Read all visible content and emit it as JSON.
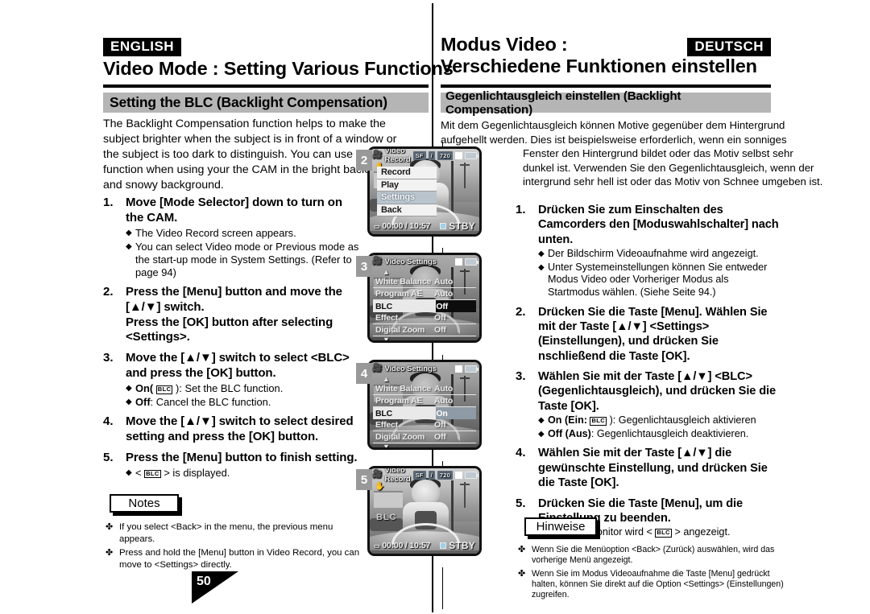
{
  "page": {
    "number": "50"
  },
  "english": {
    "lang_badge": "ENGLISH",
    "chapter_title_line1": "Video Mode : Setting Various Functions",
    "section_title": "Setting the BLC (Backlight Compensation)",
    "intro": "The Backlight Compensation function helps to make the subject brighter when the subject is in front of a window or the subject is too dark to distinguish. You can use this function when using your the CAM in the bright background and snowy background.",
    "steps": [
      {
        "num": "1.",
        "head": "Move [Mode Selector] down to turn on the CAM.",
        "bullets": [
          "The Video Record screen appears.",
          "You can select Video mode or Previous mode as the start-up mode in System Settings. (Refer to page 94)"
        ]
      },
      {
        "num": "2.",
        "head": "Press the [Menu] button and move the [▲/▼] switch.\nPress the [OK] button after selecting <Settings>.",
        "bullets": []
      },
      {
        "num": "3.",
        "head": "Move the [▲/▼] switch to select <BLC> and press the [OK] button.",
        "bullets": [
          "On( BLC ): Set the BLC function.",
          "Off: Cancel the BLC function."
        ],
        "bullets_rich": [
          {
            "bold": "On(",
            "glyph": "BLC",
            "rest": "): Set the BLC function."
          },
          {
            "bold": "Off",
            "rest": ": Cancel the BLC function."
          }
        ]
      },
      {
        "num": "4.",
        "head": "Move the [▲/▼] switch to select desired setting and press the [OK] button.",
        "bullets": []
      },
      {
        "num": "5.",
        "head": "Press the [Menu] button to finish setting.",
        "bullets": [],
        "bullets_rich": [
          {
            "pre": "< ",
            "glyph": "BLC",
            "rest": " > is displayed."
          }
        ]
      }
    ],
    "notes_label": "Notes",
    "notes": [
      "If you select <Back> in the menu, the previous menu appears.",
      "Press and hold the [Menu] button in Video Record, you can move to <Settings> directly."
    ]
  },
  "german": {
    "lang_badge": "DEUTSCH",
    "chapter_title_line1": "Modus Video :",
    "chapter_title_line2": "Verschiedene Funktionen einstellen",
    "section_title": "Gegenlichtausgleich einstellen (Backlight Compensation)",
    "intro_lines": [
      "Mit dem Gegenlichtausgleich können Motive gegenüber dem Hintergrund",
      "aufgehellt werden. Dies ist beispielsweise erforderlich, wenn ein sonniges",
      "Fenster den Hintergrund bildet oder das Motiv selbst sehr",
      "dunkel ist. Verwenden Sie den Gegenlichtausgleich, wenn der",
      "intergrund sehr hell ist oder das Motiv von Schnee umgeben ist."
    ],
    "steps": [
      {
        "num": "1.",
        "head": "Drücken Sie zum Einschalten des Camcorders den [Moduswahlschalter] nach unten.",
        "bullets": [
          "Der Bildschirm Videoaufnahme wird angezeigt.",
          "Unter Systemeinstellungen können Sie entweder Modus Video oder Vorheriger Modus als Startmodus wählen. (Siehe Seite 94.)"
        ]
      },
      {
        "num": "2.",
        "head": "Drücken Sie die Taste [Menu]. Wählen Sie mit der Taste [▲/▼] <Settings> (Einstellungen), und drücken Sie nschließend die Taste [OK].",
        "bullets": []
      },
      {
        "num": "3.",
        "head": "Wählen Sie mit der Taste [▲/▼] <BLC> (Gegenlichtausgleich), und drücken Sie die Taste [OK].",
        "bullets_rich": [
          {
            "bold": "On (Ein:",
            "glyph": "BLC",
            "rest": "): Gegenlichtausgleich aktivieren"
          },
          {
            "bold": "Off (Aus)",
            "rest": ": Gegenlichtausgleich deaktivieren."
          }
        ]
      },
      {
        "num": "4.",
        "head": "Wählen Sie mit der Taste [▲/▼]  die gewünschte Einstellung, und drücken Sie die Taste [OK].",
        "bullets": []
      },
      {
        "num": "5.",
        "head": "Drücken Sie die Taste [Menu], um die Einstellung zu beenden.",
        "bullets_rich": [
          {
            "pre": "Auf dem Monitor wird < ",
            "glyph": "BLC",
            "rest": " > angezeigt."
          }
        ]
      }
    ],
    "notes_label": "Hinweise",
    "notes": [
      "Wenn Sie die Menüoption <Back> (Zurück) auswählen, wird das vorherige Menü angezeigt.",
      "Wenn Sie im Modus Videoaufnahme die Taste [Menu] gedrückt halten, können Sie direkt auf die Option <Settings> (Einstellungen) zugreifen."
    ]
  },
  "screens": [
    {
      "label": "2",
      "osd_title": "Video Record",
      "osd_quality": "SF",
      "osd_sep": "/",
      "osd_res": "720",
      "timecode": "00:00 / 10:57",
      "status": "STBY",
      "menu": [
        {
          "label": "Record",
          "selected": false
        },
        {
          "label": "Play",
          "selected": false
        },
        {
          "label": "Settings",
          "selected": true
        },
        {
          "label": "Back",
          "selected": false
        }
      ]
    },
    {
      "label": "3",
      "osd_title": "Video Settings",
      "rows": [
        {
          "label": "White Balance",
          "value": "Auto",
          "selected": false
        },
        {
          "label": "Program AE",
          "value": "Auto",
          "selected": false
        },
        {
          "label": "BLC",
          "value": "Off",
          "selected": true
        },
        {
          "label": "Effect",
          "value": "Off",
          "selected": false
        },
        {
          "label": "Digital Zoom",
          "value": "Off",
          "selected": false
        }
      ]
    },
    {
      "label": "4",
      "osd_title": "Video Settings",
      "rows": [
        {
          "label": "White Balance",
          "value": "Auto",
          "selected": false
        },
        {
          "label": "Program AE",
          "value": "Auto",
          "selected": false
        },
        {
          "label": "BLC",
          "value": "On",
          "selected": true
        },
        {
          "label": "Effect",
          "value": "Off",
          "selected": false
        },
        {
          "label": "Digital Zoom",
          "value": "Off",
          "selected": false
        }
      ]
    },
    {
      "label": "5",
      "osd_title": "Video Record",
      "osd_quality": "SF",
      "osd_sep": "/",
      "osd_res": "720",
      "timecode": "00:00 / 10:57",
      "status": "STBY",
      "blc_indicator": "BLC"
    }
  ],
  "icons": {
    "camcorder": "camcorder-icon",
    "battery": "battery-icon",
    "memory_card": "memory-card-icon",
    "hand": "hand-shake-icon",
    "diamond_bullet": "◆",
    "note_marker": "✤"
  },
  "colors": {
    "section_bar": "#b5b5b5",
    "badge_bg": "#000000",
    "screen_label_bg": "#999999",
    "menu_selected": "#b9c4cd"
  }
}
